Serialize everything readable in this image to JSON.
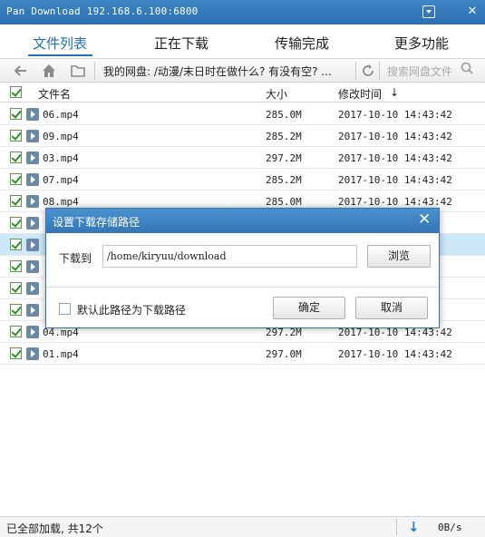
{
  "window": {
    "title": "Pan Download  192.168.6.100:6800"
  },
  "tabs": [
    "文件列表",
    "正在下载",
    "传输完成",
    "更多功能"
  ],
  "toolbar": {
    "path_text": "我的网盘: /动漫/末日时在做什么? 有没有空? ...",
    "search_placeholder": "搜索网盘文件"
  },
  "columns": {
    "name": "文件名",
    "size": "大小",
    "time": "修改时间",
    "sort_indicator": "↓"
  },
  "files": [
    {
      "name": "06.mp4",
      "size": "285.0M",
      "time": "2017-10-10 14:43:42",
      "checked": true,
      "selected": false
    },
    {
      "name": "09.mp4",
      "size": "285.2M",
      "time": "2017-10-10 14:43:42",
      "checked": true,
      "selected": false
    },
    {
      "name": "03.mp4",
      "size": "297.2M",
      "time": "2017-10-10 14:43:42",
      "checked": true,
      "selected": false
    },
    {
      "name": "07.mp4",
      "size": "285.2M",
      "time": "2017-10-10 14:43:42",
      "checked": true,
      "selected": false
    },
    {
      "name": "08.mp4",
      "size": "285.0M",
      "time": "2017-10-10 14:43:42",
      "checked": true,
      "selected": false
    },
    {
      "name": "",
      "size": "",
      "time": "",
      "checked": true,
      "selected": false
    },
    {
      "name": "",
      "size": "",
      "time": "",
      "checked": true,
      "selected": true
    },
    {
      "name": "",
      "size": "",
      "time": "",
      "checked": true,
      "selected": false
    },
    {
      "name": "",
      "size": "",
      "time": "",
      "checked": true,
      "selected": false
    },
    {
      "name": "",
      "size": "",
      "time": "",
      "checked": true,
      "selected": false
    },
    {
      "name": "04.mp4",
      "size": "297.2M",
      "time": "2017-10-10 14:43:42",
      "checked": true,
      "selected": false
    },
    {
      "name": "01.mp4",
      "size": "297.0M",
      "time": "2017-10-10 14:43:42",
      "checked": true,
      "selected": false
    }
  ],
  "status": {
    "text": "已全部加载, 共12个",
    "speed": "0B/s"
  },
  "dialog": {
    "title": "设置下载存储路径",
    "label": "下载到",
    "path_value": "/home/kiryuu/download",
    "browse_label": "浏览",
    "default_checkbox_label": "默认此路径为下载路径",
    "default_checked": false,
    "ok_label": "确定",
    "cancel_label": "取消"
  },
  "colors": {
    "titlebar": "#2a6eb0",
    "active_tab": "#1f6fc1",
    "selected_row": "#cde8f9",
    "checkbox_green": "#2f8a2a"
  }
}
